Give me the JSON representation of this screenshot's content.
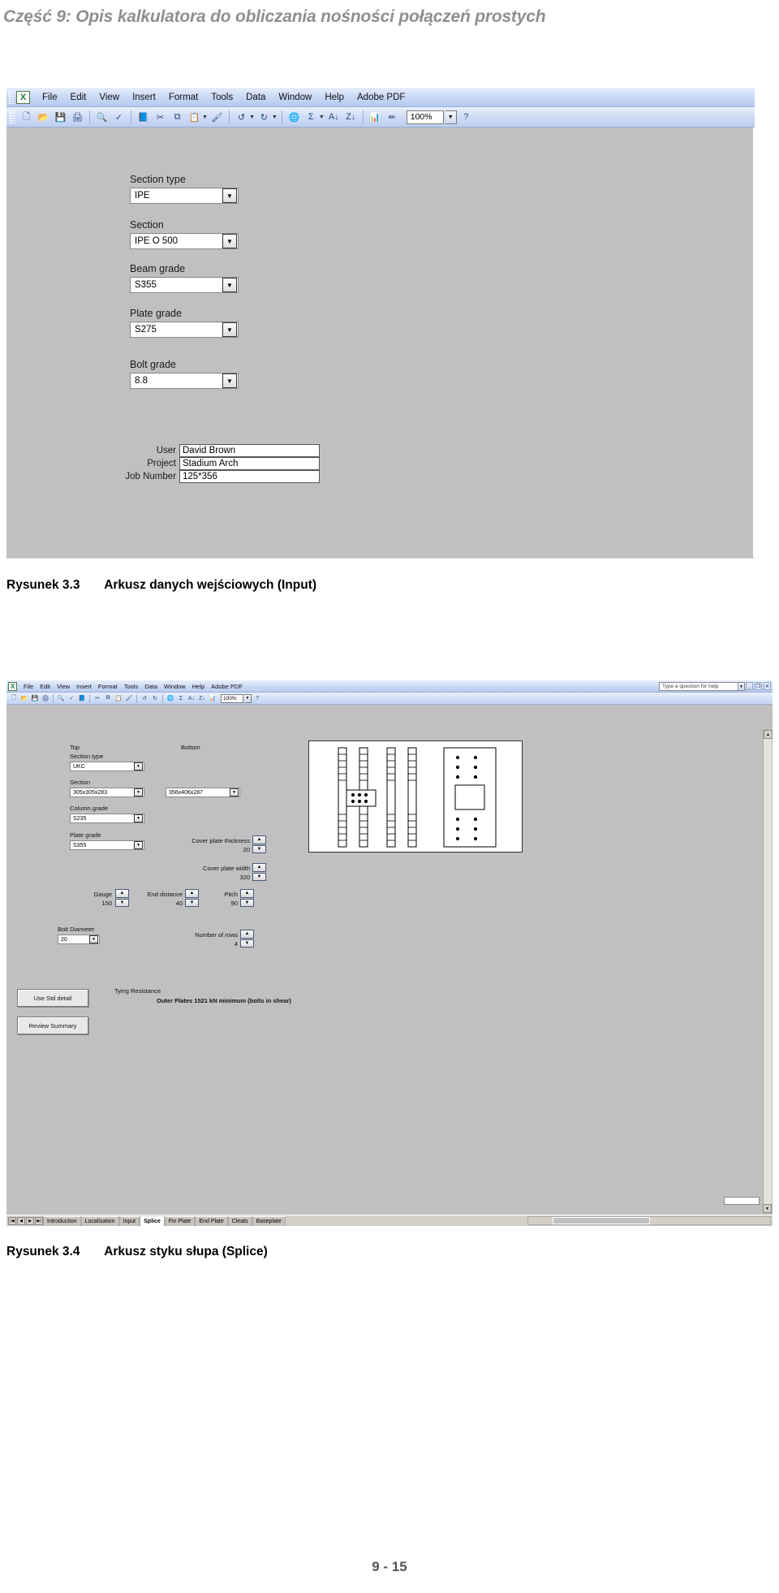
{
  "page": {
    "header": "Część 9: Opis kalkulatora do obliczania nośności połączeń prostych",
    "number": "9 - 15"
  },
  "figure1": {
    "caption_number": "Rysunek 3.3",
    "caption_text": "Arkusz danych wejściowych (Input)",
    "app": {
      "icon": "excel-icon",
      "menus": [
        "File",
        "Edit",
        "View",
        "Insert",
        "Format",
        "Tools",
        "Data",
        "Window",
        "Help",
        "Adobe PDF"
      ],
      "zoom": "100%",
      "toolbar_icons": [
        "new-icon",
        "open-icon",
        "save-icon",
        "print-icon",
        "print-preview-icon",
        "spelling-icon",
        "research-icon",
        "cut-icon",
        "copy-icon",
        "paste-icon",
        "format-painter-icon",
        "undo-icon",
        "redo-icon",
        "hyperlink-icon",
        "autosum-icon",
        "sort-asc-icon",
        "sort-desc-icon",
        "chart-icon",
        "drawing-icon",
        "help-icon"
      ]
    },
    "form": {
      "fields": [
        {
          "label": "Section type",
          "value": "IPE"
        },
        {
          "label": "Section",
          "value": "IPE O 500"
        },
        {
          "label": "Beam grade",
          "value": "S355"
        },
        {
          "label": "Plate grade",
          "value": "S275"
        },
        {
          "label": "Bolt grade",
          "value": "8.8"
        }
      ],
      "text_fields": [
        {
          "label": "User",
          "value": "David Brown"
        },
        {
          "label": "Project",
          "value": "Stadium Arch"
        },
        {
          "label": "Job Number",
          "value": "125*356"
        }
      ]
    }
  },
  "figure2": {
    "caption_number": "Rysunek 3.4",
    "caption_text": "Arkusz styku słupa (Splice)",
    "app": {
      "icon": "excel-icon",
      "menus": [
        "File",
        "Edit",
        "View",
        "Insert",
        "Format",
        "Tools",
        "Data",
        "Window",
        "Help",
        "Adobe PDF"
      ],
      "ask_placeholder": "Type a question for help",
      "zoom": "100%",
      "window_buttons": [
        "minimize-icon",
        "restore-icon",
        "close-icon"
      ]
    },
    "form": {
      "column_headers": {
        "top": "Top",
        "bottom": "Bottom"
      },
      "section_type": {
        "label": "Section type",
        "top": "UKC"
      },
      "section": {
        "label": "Section",
        "top": "305x305x283",
        "bottom": "356x406x287"
      },
      "column_grade": {
        "label": "Column grade",
        "top": "S235"
      },
      "plate_grade": {
        "label": "Plate grade",
        "top": "S355"
      },
      "spinners": [
        {
          "label": "Cover plate thickness",
          "value": "20"
        },
        {
          "label": "Cover plate width",
          "value": "320"
        },
        {
          "label": "Gauge",
          "value": "150"
        },
        {
          "label": "End distance",
          "value": "40"
        },
        {
          "label": "Pitch",
          "value": "90"
        },
        {
          "label": "Number of rows",
          "value": "4"
        }
      ],
      "bolt_diameter": {
        "label": "Bolt Diameter",
        "value": "20"
      },
      "tying": {
        "title": "Tying Resistance",
        "text": "Outer Plates 1521 kN minimum (bolts in shear)"
      },
      "buttons": [
        {
          "label": "Use Std detail"
        },
        {
          "label": "Review Summary"
        }
      ]
    },
    "sheet_tabs": [
      {
        "label": "Introduction",
        "active": false
      },
      {
        "label": "Localisation",
        "active": false
      },
      {
        "label": "Input",
        "active": false
      },
      {
        "label": "Splice",
        "active": true
      },
      {
        "label": "Fin Plate",
        "active": false
      },
      {
        "label": "End Plate",
        "active": false
      },
      {
        "label": "Cleats",
        "active": false
      },
      {
        "label": "Baseplate",
        "active": false
      }
    ]
  }
}
